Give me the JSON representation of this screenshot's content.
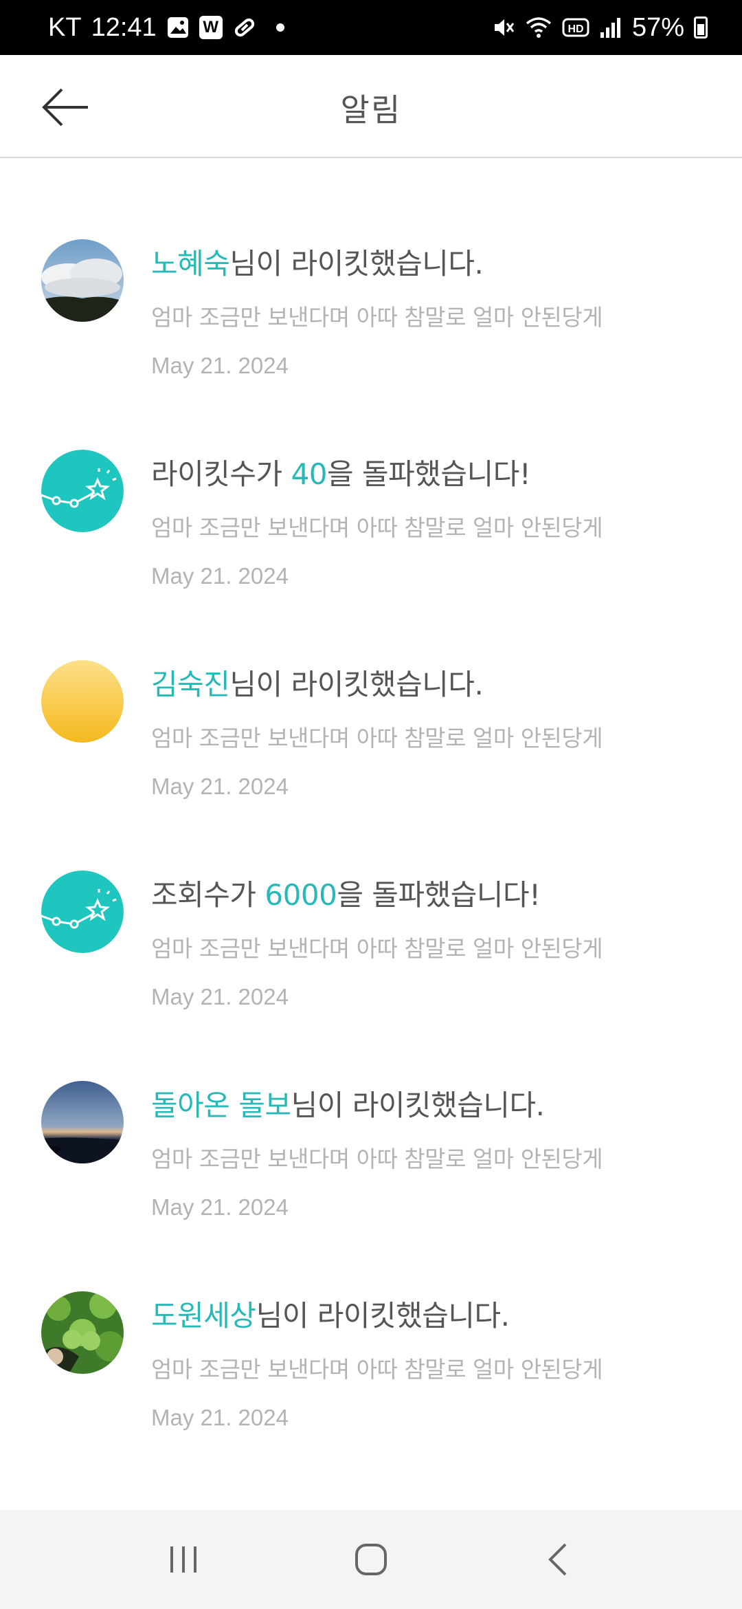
{
  "status_bar": {
    "carrier": "KT",
    "time": "12:41",
    "w_icon_label": "W",
    "battery": "57%"
  },
  "header": {
    "title": "알림"
  },
  "notifications": [
    {
      "highlight": "노혜숙",
      "suffix": "님이 라이킷했습니다.",
      "excerpt": "엄마 조금만 보낸다며 아따 참말로 얼마 안된당게",
      "date": "May 21. 2024",
      "avatar": "cloud-photo"
    },
    {
      "prefix": "라이킷수가 ",
      "highlight": "40",
      "suffix": "을 돌파했습니다!",
      "excerpt": "엄마 조금만 보낸다며 아따 참말로 얼마 안된당게",
      "date": "May 21. 2024",
      "avatar": "milestone-star-icon"
    },
    {
      "highlight": "김숙진",
      "suffix": "님이 라이킷했습니다.",
      "excerpt": "엄마 조금만 보낸다며 아따 참말로 얼마 안된당게",
      "date": "May 21. 2024",
      "avatar": "yellow-gradient"
    },
    {
      "prefix": "조회수가 ",
      "highlight": "6000",
      "suffix": "을 돌파했습니다!",
      "excerpt": "엄마 조금만 보낸다며 아따 참말로 얼마 안된당게",
      "date": "May 21. 2024",
      "avatar": "milestone-star-icon"
    },
    {
      "highlight": "돌아온 돌보",
      "suffix": "님이 라이킷했습니다.",
      "excerpt": "엄마 조금만 보낸다며 아따 참말로 얼마 안된당게",
      "date": "May 21. 2024",
      "avatar": "sunset-photo"
    },
    {
      "highlight": "도원세상",
      "suffix": "님이 라이킷했습니다.",
      "excerpt": "엄마 조금만 보낸다며 아따 참말로 얼마 안된당게",
      "date": "May 21. 2024",
      "avatar": "clover-photo"
    }
  ],
  "colors": {
    "accent": "#27b8b8",
    "milestone_bg": "#1fc6c0"
  }
}
